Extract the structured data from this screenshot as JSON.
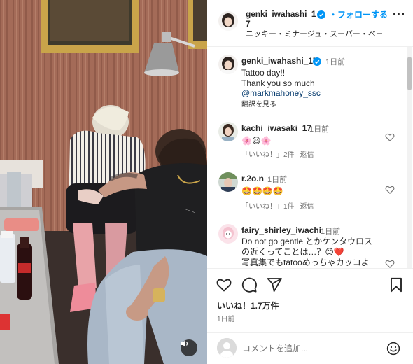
{
  "post": {
    "author": {
      "username": "genki_iwahashi_1\n7",
      "verified": true,
      "follow_label": "・フォローする",
      "subtitle": "ニッキー・ミナージュ・スーパー・ベー..."
    },
    "caption": {
      "username": "genki_iwahashi_17",
      "time": "1日前",
      "lines": [
        "Tattoo day!!",
        "Thank you so much"
      ],
      "mention": "@markmahoney_ssc",
      "translate_label": "翻訳を見る"
    },
    "comments": [
      {
        "username": "kachi_iwasaki_17",
        "time": "1日前",
        "text": "🌸😃🌸",
        "like_label": "「いいね！」2件",
        "reply_label": "返信"
      },
      {
        "username": "r.2o.n",
        "time": "1日前",
        "text": "🤩🤩🤩🤩",
        "like_label": "「いいね！」1件",
        "reply_label": "返信"
      },
      {
        "username": "fairy_shirley_iwachi",
        "time": "1日前",
        "text_lines": [
          "Do not go gentle とかケンタウロス",
          "の近くってことは…？😊❤️",
          "写真集でもtatooめっちゃカッコよ"
        ]
      }
    ],
    "likes": "いいね！1.7万件",
    "posted_time": "1日前",
    "composer": {
      "placeholder": "コメントを追加..."
    }
  },
  "icons": {
    "more": "more-options-icon",
    "verified": "verified-badge-icon",
    "like": "heart-icon",
    "comment": "comment-icon",
    "share": "share-icon",
    "save": "bookmark-icon",
    "sound": "speaker-icon",
    "emoji": "emoji-icon"
  },
  "colors": {
    "accent": "#0095f6",
    "text": "#262626",
    "secondary": "#737373",
    "mention": "#00376b"
  }
}
